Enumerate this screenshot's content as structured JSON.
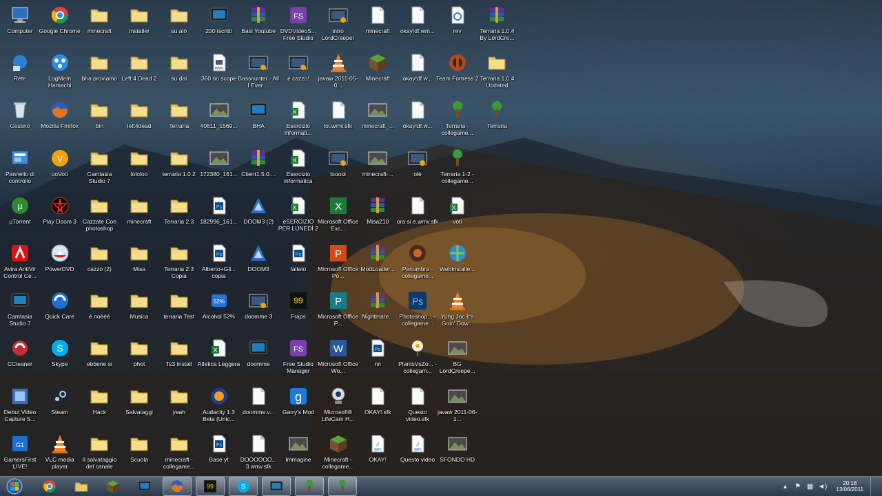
{
  "desktop": {
    "columns": [
      [
        {
          "label": "Computer",
          "icon": "computer-icon"
        },
        {
          "label": "Rete",
          "icon": "network-icon"
        },
        {
          "label": "Cestino",
          "icon": "recycle-bin-icon"
        },
        {
          "label": "Pannello di controllo",
          "icon": "control-panel-icon"
        },
        {
          "label": "µTorrent",
          "icon": "utorrent-icon"
        },
        {
          "label": "Avira AntiVir Control Ce...",
          "icon": "avira-icon"
        },
        {
          "label": "Camtasia Studio 7",
          "icon": "camtasia-icon"
        },
        {
          "label": "CCleaner",
          "icon": "ccleaner-icon"
        },
        {
          "label": "Debut Video Capture S...",
          "icon": "debut-video-icon"
        },
        {
          "label": "GamersFirst LIVE!",
          "icon": "gamersfirst-icon"
        }
      ],
      [
        {
          "label": "Google Chrome",
          "icon": "chrome-icon"
        },
        {
          "label": "LogMeIn Hamachi",
          "icon": "hamachi-icon"
        },
        {
          "label": "Mozilla Firefox",
          "icon": "firefox-icon"
        },
        {
          "label": "ooVoo",
          "icon": "oovoo-icon"
        },
        {
          "label": "Play Doom 3",
          "icon": "doom3-icon"
        },
        {
          "label": "PowerDVD",
          "icon": "powerdvd-icon"
        },
        {
          "label": "Quick Care",
          "icon": "quick-care-icon"
        },
        {
          "label": "Skype",
          "icon": "skype-icon"
        },
        {
          "label": "Steam",
          "icon": "steam-icon"
        },
        {
          "label": "VLC media player",
          "icon": "vlc-icon"
        }
      ],
      [
        {
          "label": "minecraft",
          "icon": "folder-icon"
        },
        {
          "label": "bha proviamo",
          "icon": "folder-icon"
        },
        {
          "label": "bin",
          "icon": "folder-icon"
        },
        {
          "label": "Camtasia Studio 7",
          "icon": "folder-icon"
        },
        {
          "label": "Cazzate Con photoshop",
          "icon": "folder-icon"
        },
        {
          "label": "cazzo (2)",
          "icon": "folder-icon"
        },
        {
          "label": "è noèèè",
          "icon": "folder-icon"
        },
        {
          "label": "ebbene si",
          "icon": "folder-icon"
        },
        {
          "label": "Hack",
          "icon": "folder-icon"
        },
        {
          "label": "Il salvataggio del canale",
          "icon": "folder-icon"
        }
      ],
      [
        {
          "label": "Installer",
          "icon": "folder-icon"
        },
        {
          "label": "Left 4 Dead 2",
          "icon": "folder-icon"
        },
        {
          "label": "left4dead",
          "icon": "folder-icon"
        },
        {
          "label": "lololoo",
          "icon": "folder-icon"
        },
        {
          "label": "minecraft",
          "icon": "folder-icon"
        },
        {
          "label": "Misa",
          "icon": "folder-icon"
        },
        {
          "label": "Musica",
          "icon": "folder-icon"
        },
        {
          "label": "phot",
          "icon": "folder-icon"
        },
        {
          "label": "Salvataggi",
          "icon": "folder-icon"
        },
        {
          "label": "Scuola",
          "icon": "folder-icon"
        }
      ],
      [
        {
          "label": "su alò",
          "icon": "folder-icon"
        },
        {
          "label": "su dai",
          "icon": "folder-icon"
        },
        {
          "label": "Terraria",
          "icon": "folder-icon"
        },
        {
          "label": "terraria 1.0.2",
          "icon": "folder-icon"
        },
        {
          "label": "Terraria 2.3",
          "icon": "folder-icon"
        },
        {
          "label": "Terraria 2.3 Copia",
          "icon": "folder-icon"
        },
        {
          "label": "terraria Test",
          "icon": "folder-icon"
        },
        {
          "label": "Ts3 Install",
          "icon": "folder-icon"
        },
        {
          "label": "yeah",
          "icon": "folder-icon"
        },
        {
          "label": "minecraft - collegame...",
          "icon": "folder-icon"
        }
      ],
      [
        {
          "label": "200 iscritti",
          "icon": "camtasia-project-icon"
        },
        {
          "label": "360 no scope",
          "icon": "wmv-file-icon"
        },
        {
          "label": "40611_1569...",
          "icon": "image-file-icon"
        },
        {
          "label": "172380_161...",
          "icon": "image-file-icon"
        },
        {
          "label": "182996_161...",
          "icon": "photoshop-file-icon"
        },
        {
          "label": "Alberto+Gil... copia",
          "icon": "photoshop-file-icon"
        },
        {
          "label": "Alcohol 52%",
          "icon": "alcohol-icon"
        },
        {
          "label": "Atletica Leggera",
          "icon": "excel-file-icon"
        },
        {
          "label": "Audacity 1.3 Beta (Unic...",
          "icon": "audacity-icon"
        },
        {
          "label": "Base yt",
          "icon": "photoshop-file-icon"
        }
      ],
      [
        {
          "label": "Basi Youtube",
          "icon": "winrar-icon"
        },
        {
          "label": "Bassnunter - All I Ever ...",
          "icon": "video-file-icon"
        },
        {
          "label": "BHA",
          "icon": "camtasia-project-icon"
        },
        {
          "label": "Client1.5.0....",
          "icon": "winrar-icon"
        },
        {
          "label": "DOOM3 (2)",
          "icon": "doom3-app-icon"
        },
        {
          "label": "DOOM3",
          "icon": "doom3-app-icon"
        },
        {
          "label": "doomme 3",
          "icon": "video-file-icon"
        },
        {
          "label": "doomme",
          "icon": "camtasia-project-icon"
        },
        {
          "label": "doomme.v...",
          "icon": "blank-file-icon"
        },
        {
          "label": "DOOOOOO... 3.wmv.sfk",
          "icon": "blank-file-icon"
        }
      ],
      [
        {
          "label": "DVDVideoS... Free Studio",
          "icon": "free-studio-icon"
        },
        {
          "label": "e cazzo!",
          "icon": "video-file-icon"
        },
        {
          "label": "Esercizio informati...",
          "icon": "excel-file-icon"
        },
        {
          "label": "Esercizio informatica",
          "icon": "excel-file-icon"
        },
        {
          "label": "eSERCIZIO PER LUNEDÌ 2",
          "icon": "excel-file-icon"
        },
        {
          "label": "failato",
          "icon": "photoshop-file-icon"
        },
        {
          "label": "Fraps",
          "icon": "fraps-icon"
        },
        {
          "label": "Free Studio Manager",
          "icon": "free-studio-icon"
        },
        {
          "label": "Garry's Mod",
          "icon": "garrys-mod-icon"
        },
        {
          "label": "Immagine",
          "icon": "image-file-icon"
        }
      ],
      [
        {
          "label": "intro LordCreeper",
          "icon": "video-file-icon"
        },
        {
          "label": "javaw 2011-05-0...",
          "icon": "vlc-file-icon"
        },
        {
          "label": "lol.wmv.sfk",
          "icon": "blank-file-icon"
        },
        {
          "label": "looool",
          "icon": "video-file-icon"
        },
        {
          "label": "Microsoft Office Exc...",
          "icon": "excel-app-icon"
        },
        {
          "label": "Microsoft Office Po...",
          "icon": "powerpoint-app-icon"
        },
        {
          "label": "Microsoft Office P...",
          "icon": "publisher-app-icon"
        },
        {
          "label": "Microsoft Office Wo...",
          "icon": "word-app-icon"
        },
        {
          "label": "Microsoft® LifeCam H...",
          "icon": "lifecam-icon"
        },
        {
          "label": "Minecraft - collegame...",
          "icon": "minecraft-icon"
        }
      ],
      [
        {
          "label": "minecraft",
          "icon": "text-file-icon"
        },
        {
          "label": "Minecraft",
          "icon": "minecraft-icon"
        },
        {
          "label": "minecraft_...",
          "icon": "image-file-icon"
        },
        {
          "label": "minecraft-...",
          "icon": "image-file-icon"
        },
        {
          "label": "Misa210",
          "icon": "winrar-icon"
        },
        {
          "label": "ModLoader...",
          "icon": "winrar-icon"
        },
        {
          "label": "Nightmare...",
          "icon": "winrar-icon"
        },
        {
          "label": "nn",
          "icon": "photoshop-file-icon"
        },
        {
          "label": "OKAY!.sfk",
          "icon": "blank-file-icon"
        },
        {
          "label": "OKAY!",
          "icon": "wav-file-icon"
        }
      ],
      [
        {
          "label": "okay!df.wm...",
          "icon": "blank-file-icon"
        },
        {
          "label": "okay!df.w...",
          "icon": "blank-file-icon"
        },
        {
          "label": "okay!df.w...",
          "icon": "blank-file-icon"
        },
        {
          "label": "olè",
          "icon": "video-file-icon"
        },
        {
          "label": "ora si e.wmv.sfk",
          "icon": "blank-file-icon"
        },
        {
          "label": "Penumbra - collegame...",
          "icon": "penumbra-icon"
        },
        {
          "label": "Photoshop... - collegame...",
          "icon": "photoshop-app-icon"
        },
        {
          "label": "PlantsVsZo... - collegam...",
          "icon": "plants-vs-zombies-icon"
        },
        {
          "label": "Questo video.sfk",
          "icon": "blank-file-icon"
        },
        {
          "label": "Questo video",
          "icon": "wav-file-icon"
        }
      ],
      [
        {
          "label": "rev",
          "icon": "settings-file-icon"
        },
        {
          "label": "Team Fortress 2",
          "icon": "team-fortress-icon"
        },
        {
          "label": "Terraria - collegame...",
          "icon": "terraria-icon"
        },
        {
          "label": "Terraria 1-2 - collegame...",
          "icon": "terraria-icon"
        },
        {
          "label": "voti",
          "icon": "excel-file-icon"
        },
        {
          "label": "WebInstalle...",
          "icon": "web-installer-icon"
        },
        {
          "label": "Yung Joc It's Goin' Dow...",
          "icon": "vlc-file-icon"
        },
        {
          "label": "BG LordCreepe...",
          "icon": "image-file-icon"
        },
        {
          "label": "javaw 2011-06-1...",
          "icon": "image-file-icon"
        },
        {
          "label": "SFONDO HD",
          "icon": "image-file-icon"
        }
      ],
      [
        {
          "label": "Terraria 1.0.4 By LordCre...",
          "icon": "winrar-icon"
        },
        {
          "label": "Terraria 1.0.4 Updated",
          "icon": "folder-icon"
        },
        {
          "label": "Terraria",
          "icon": "terraria-icon"
        }
      ]
    ]
  },
  "taskbar": {
    "start": "windows-start-icon",
    "pinned": [
      {
        "name": "chrome-icon",
        "active": false
      },
      {
        "name": "explorer-folder-icon",
        "active": false
      },
      {
        "name": "minecraft-icon",
        "active": false
      },
      {
        "name": "camtasia-icon",
        "active": false
      },
      {
        "name": "firefox-icon",
        "active": true
      },
      {
        "name": "fraps-icon",
        "active": true
      },
      {
        "name": "skype-icon",
        "active": true
      },
      {
        "name": "camtasia-studio-icon",
        "active": true
      },
      {
        "name": "terraria-server-icon",
        "active": true
      },
      {
        "name": "terraria-icon",
        "active": true
      }
    ],
    "tray": {
      "time": "20:18",
      "date": "13/06/2011",
      "icons": [
        "show-hidden-icon",
        "flag-icon",
        "network-icon",
        "volume-icon"
      ]
    }
  }
}
